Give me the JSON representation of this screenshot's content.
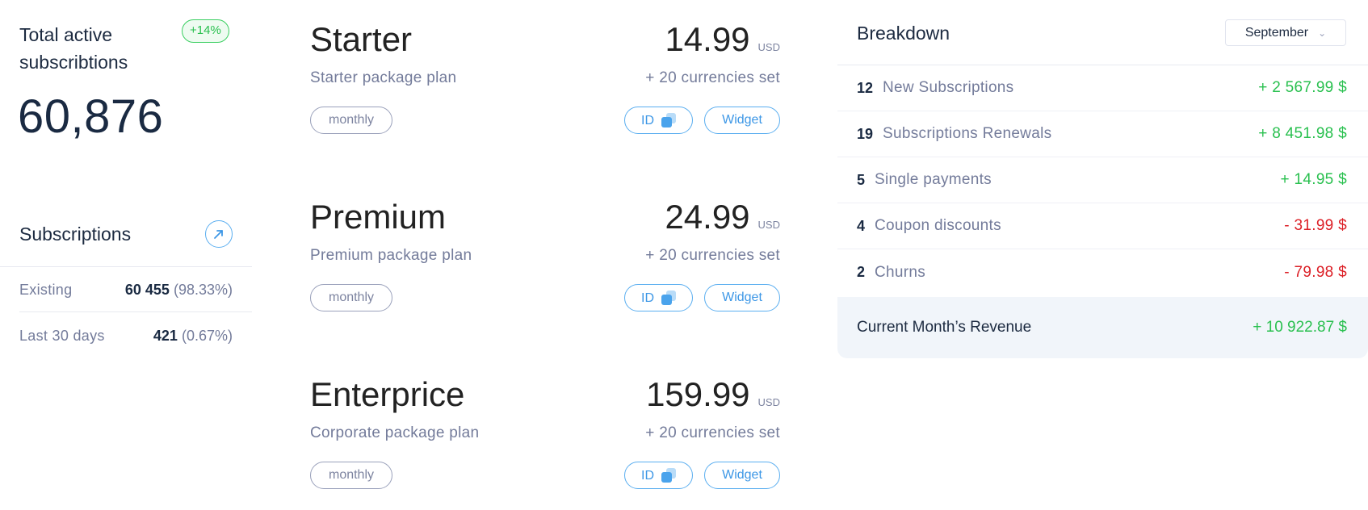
{
  "summary": {
    "title": "Total active subscribtions",
    "trend_badge": "+14%",
    "total_value": "60,876",
    "accent_green": "#29c04f"
  },
  "subscriptions": {
    "title": "Subscriptions",
    "link_icon": "arrow-up-right-icon",
    "rows": [
      {
        "label": "Existing",
        "value": "60 455",
        "percent": "(98.33%)"
      },
      {
        "label": "Last 30 days",
        "value": "421",
        "percent": "(0.67%)"
      }
    ]
  },
  "plans": [
    {
      "name": "Starter",
      "description": "Starter package plan",
      "price": "14.99",
      "currency": "USD",
      "currencies_note": "+ 20 currencies set",
      "period": "monthly",
      "id_label": "ID",
      "widget_label": "Widget"
    },
    {
      "name": "Premium",
      "description": "Premium package plan",
      "price": "24.99",
      "currency": "USD",
      "currencies_note": "+ 20 currencies set",
      "period": "monthly",
      "id_label": "ID",
      "widget_label": "Widget"
    },
    {
      "name": "Enterprice",
      "description": "Corporate package plan",
      "price": "159.99",
      "currency": "USD",
      "currencies_note": "+ 20 currencies set",
      "period": "monthly",
      "id_label": "ID",
      "widget_label": "Widget"
    }
  ],
  "breakdown": {
    "title": "Breakdown",
    "month_selected": "September",
    "rows": [
      {
        "count": "12",
        "label": "New Subscriptions",
        "amount": "+ 2 567.99 $",
        "sign": "positive"
      },
      {
        "count": "19",
        "label": "Subscriptions Renewals",
        "amount": "+ 8 451.98 $",
        "sign": "positive"
      },
      {
        "count": "5",
        "label": "Single payments",
        "amount": "+ 14.95 $",
        "sign": "positive"
      },
      {
        "count": "4",
        "label": "Coupon discounts",
        "amount": "- 31.99 $",
        "sign": "negative"
      },
      {
        "count": "2",
        "label": "Churns",
        "amount": "- 79.98 $",
        "sign": "negative"
      }
    ],
    "revenue_label": "Current Month’s Revenue",
    "revenue_amount": "+ 10 922.87 $",
    "colors": {
      "positive": "#29c04f",
      "negative": "#dc1f26"
    }
  }
}
